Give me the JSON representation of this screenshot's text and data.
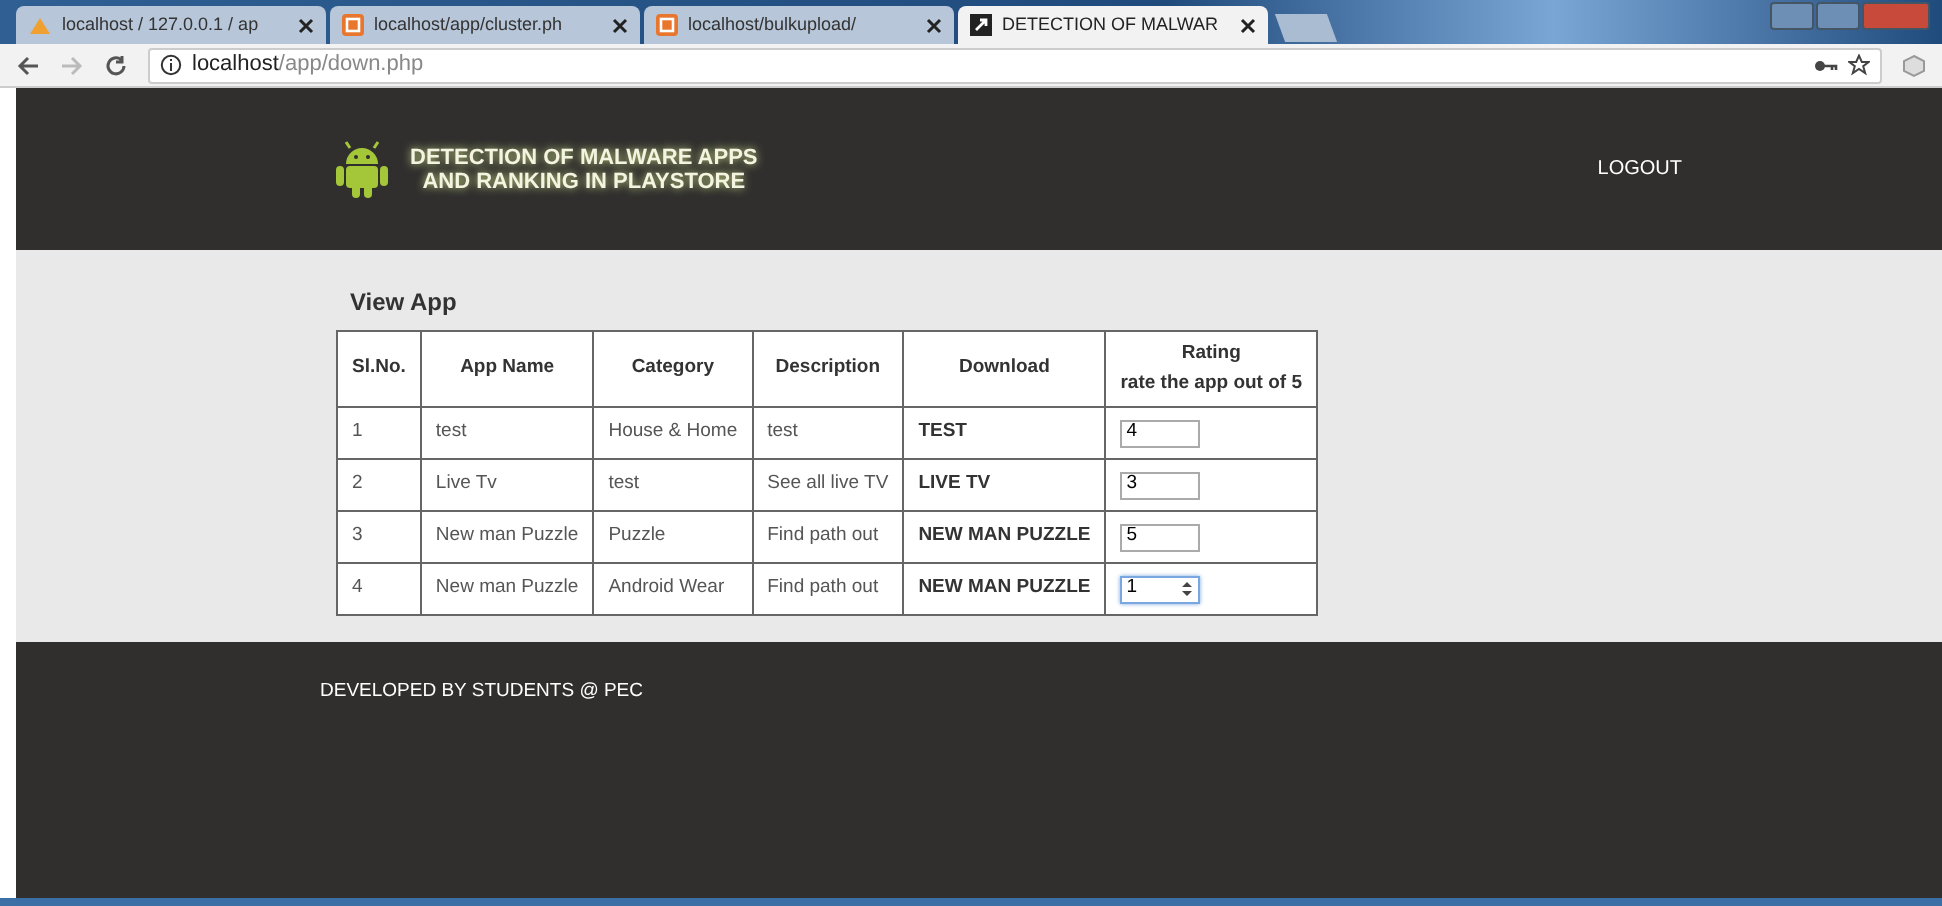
{
  "browser": {
    "tabs": [
      {
        "title": "localhost / 127.0.0.1 / ap",
        "selected": false
      },
      {
        "title": "localhost/app/cluster.ph",
        "selected": false
      },
      {
        "title": "localhost/bulkupload/",
        "selected": false
      },
      {
        "title": "DETECTION OF MALWAR",
        "selected": true
      }
    ],
    "address": {
      "host": "localhost",
      "path": "/app/down.php"
    }
  },
  "header": {
    "title_lines": [
      "DETECTION OF MALWARE APPS",
      "AND RANKING IN PLAYSTORE"
    ],
    "logout": "LOGOUT"
  },
  "section_title": "View App",
  "table": {
    "columns": [
      "Sl.No.",
      "App Name",
      "Category",
      "Description",
      "Download"
    ],
    "rating_column": {
      "title": "Rating",
      "subtitle": "rate the app out of 5"
    },
    "rows": [
      {
        "no": "1",
        "app_name": "test",
        "category": "House & Home",
        "description": "test",
        "download": "TEST",
        "rating": "4",
        "focused": false
      },
      {
        "no": "2",
        "app_name": "Live Tv",
        "category": "test",
        "description": "See all live TV",
        "download": "LIVE TV",
        "rating": "3",
        "focused": false
      },
      {
        "no": "3",
        "app_name": "New man Puzzle",
        "category": "Puzzle",
        "description": "Find path out",
        "download": "NEW MAN PUZZLE",
        "rating": "5",
        "focused": false
      },
      {
        "no": "4",
        "app_name": "New man Puzzle",
        "category": "Android Wear",
        "description": "Find path out",
        "download": "NEW MAN PUZZLE",
        "rating": "1",
        "focused": true
      }
    ]
  },
  "footer": {
    "text": "DEVELOPED BY STUDENTS @ PEC"
  }
}
